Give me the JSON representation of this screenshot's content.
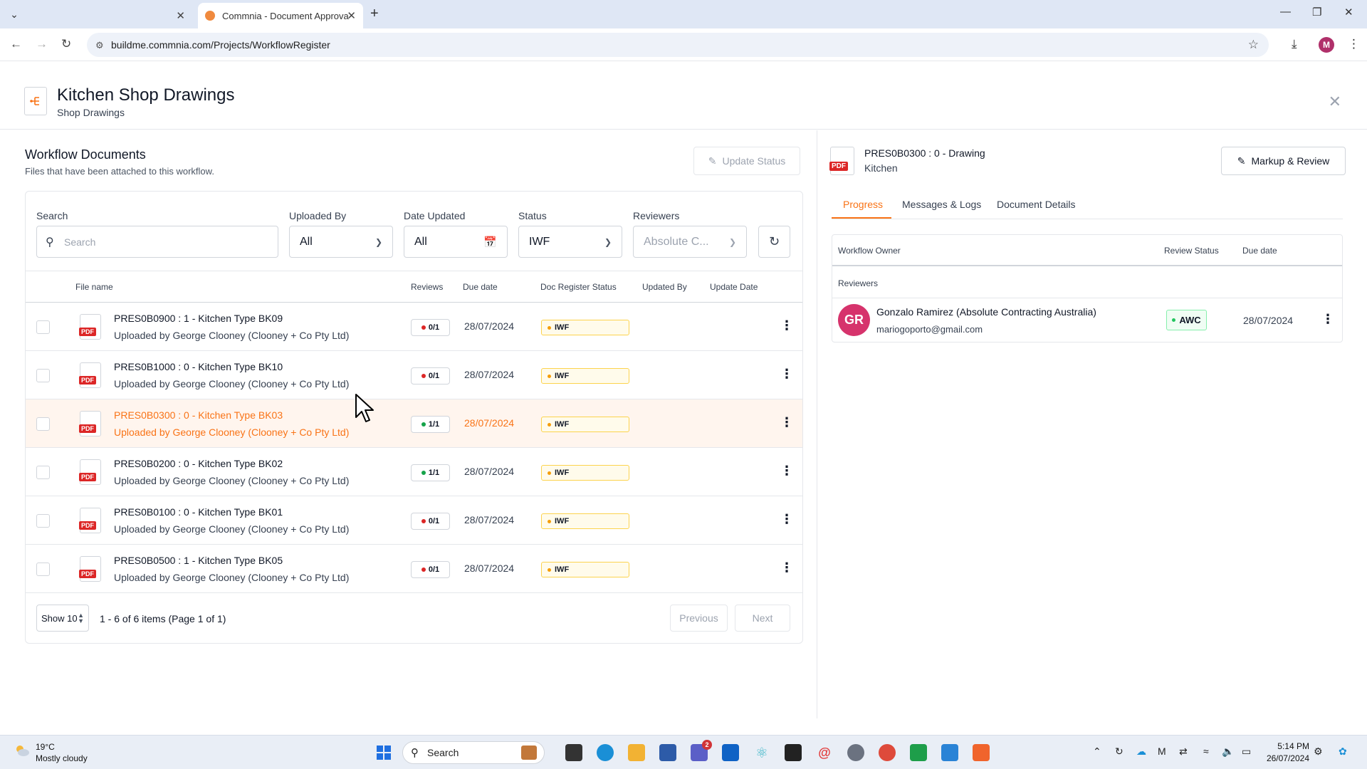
{
  "browser": {
    "tabs": [
      {
        "label": ""
      },
      {
        "label": "Commnia - Document Approva"
      }
    ],
    "url": "buildme.commnia.com/Projects/WorkflowRegister",
    "profile_initial": "M"
  },
  "header": {
    "title": "Kitchen Shop Drawings",
    "subtitle": "Shop Drawings"
  },
  "left": {
    "title": "Workflow Documents",
    "description": "Files that have been attached to this workflow.",
    "update_status_label": "Update Status",
    "filters": {
      "search_label": "Search",
      "search_placeholder": "Search",
      "uploaded_by_label": "Uploaded By",
      "uploaded_by_value": "All",
      "date_updated_label": "Date Updated",
      "date_updated_value": "All",
      "status_label": "Status",
      "status_value": "IWF",
      "reviewers_label": "Reviewers",
      "reviewers_value": "Absolute C..."
    },
    "columns": {
      "file_name": "File name",
      "reviews": "Reviews",
      "due_date": "Due date",
      "doc_register_status": "Doc Register Status",
      "updated_by": "Updated By",
      "update_date": "Update Date"
    },
    "rows": [
      {
        "name": "PRES0B0900 : 1 - Kitchen Type BK09",
        "uploaded": "Uploaded by George Clooney (Clooney + Co Pty Ltd)",
        "reviews": "0/1",
        "review_color": "#dc2626",
        "due": "28/07/2024",
        "status": "IWF"
      },
      {
        "name": "PRES0B1000 : 0 - Kitchen Type BK10",
        "uploaded": "Uploaded by George Clooney (Clooney + Co Pty Ltd)",
        "reviews": "0/1",
        "review_color": "#dc2626",
        "due": "28/07/2024",
        "status": "IWF"
      },
      {
        "name": "PRES0B0300 : 0 - Kitchen Type BK03",
        "uploaded": "Uploaded by George Clooney (Clooney + Co Pty Ltd)",
        "reviews": "1/1",
        "review_color": "#16a34a",
        "due": "28/07/2024",
        "status": "IWF"
      },
      {
        "name": "PRES0B0200 : 0 - Kitchen Type BK02",
        "uploaded": "Uploaded by George Clooney (Clooney + Co Pty Ltd)",
        "reviews": "1/1",
        "review_color": "#16a34a",
        "due": "28/07/2024",
        "status": "IWF"
      },
      {
        "name": "PRES0B0100 : 0 - Kitchen Type BK01",
        "uploaded": "Uploaded by George Clooney (Clooney + Co Pty Ltd)",
        "reviews": "0/1",
        "review_color": "#dc2626",
        "due": "28/07/2024",
        "status": "IWF"
      },
      {
        "name": "PRES0B0500 : 1 - Kitchen Type BK05",
        "uploaded": "Uploaded by George Clooney (Clooney + Co Pty Ltd)",
        "reviews": "0/1",
        "review_color": "#dc2626",
        "due": "28/07/2024",
        "status": "IWF"
      }
    ],
    "pager": {
      "show_label": "Show 10",
      "info": "1 - 6 of 6 items (Page 1 of 1)",
      "previous": "Previous",
      "next": "Next"
    }
  },
  "right": {
    "doc_title": "PRES0B0300 : 0 - Drawing",
    "doc_subtitle": "Kitchen",
    "markup_label": "Markup & Review",
    "tabs": [
      "Progress",
      "Messages & Logs",
      "Document Details"
    ],
    "table": {
      "workflow_owner": "Workflow Owner",
      "review_status": "Review Status",
      "due_date": "Due date",
      "reviewers_heading": "Reviewers"
    },
    "reviewer": {
      "initials": "GR",
      "name": "Gonzalo Ramirez (Absolute Contracting Australia)",
      "email": "mariogoporto@gmail.com",
      "status": "AWC",
      "due": "28/07/2024"
    }
  },
  "taskbar": {
    "temperature": "19°C",
    "weather": "Mostly cloudy",
    "search_label": "Search",
    "teams_badge": "2",
    "time": "5:14 PM",
    "date": "26/07/2024"
  },
  "pdf_label": "PDF",
  "accent_color": "#f97316"
}
